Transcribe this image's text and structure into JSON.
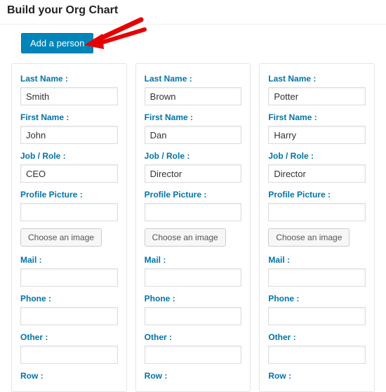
{
  "title": "Build your Org Chart",
  "toolbar": {
    "add_label": "Add a person"
  },
  "labels": {
    "last_name": "Last Name :",
    "first_name": "First Name :",
    "job_role": "Job / Role :",
    "profile_picture": "Profile Picture :",
    "choose_image": "Choose an image",
    "mail": "Mail :",
    "phone": "Phone :",
    "other": "Other :",
    "row": "Row :"
  },
  "people": [
    {
      "last_name": "Smith",
      "first_name": "John",
      "job": "CEO",
      "picture": "",
      "mail": "",
      "phone": "",
      "other": "",
      "row": ""
    },
    {
      "last_name": "Brown",
      "first_name": "Dan",
      "job": "Director",
      "picture": "",
      "mail": "",
      "phone": "",
      "other": "",
      "row": ""
    },
    {
      "last_name": "Potter",
      "first_name": "Harry",
      "job": "Director",
      "picture": "",
      "mail": "",
      "phone": "",
      "other": "",
      "row": ""
    }
  ]
}
